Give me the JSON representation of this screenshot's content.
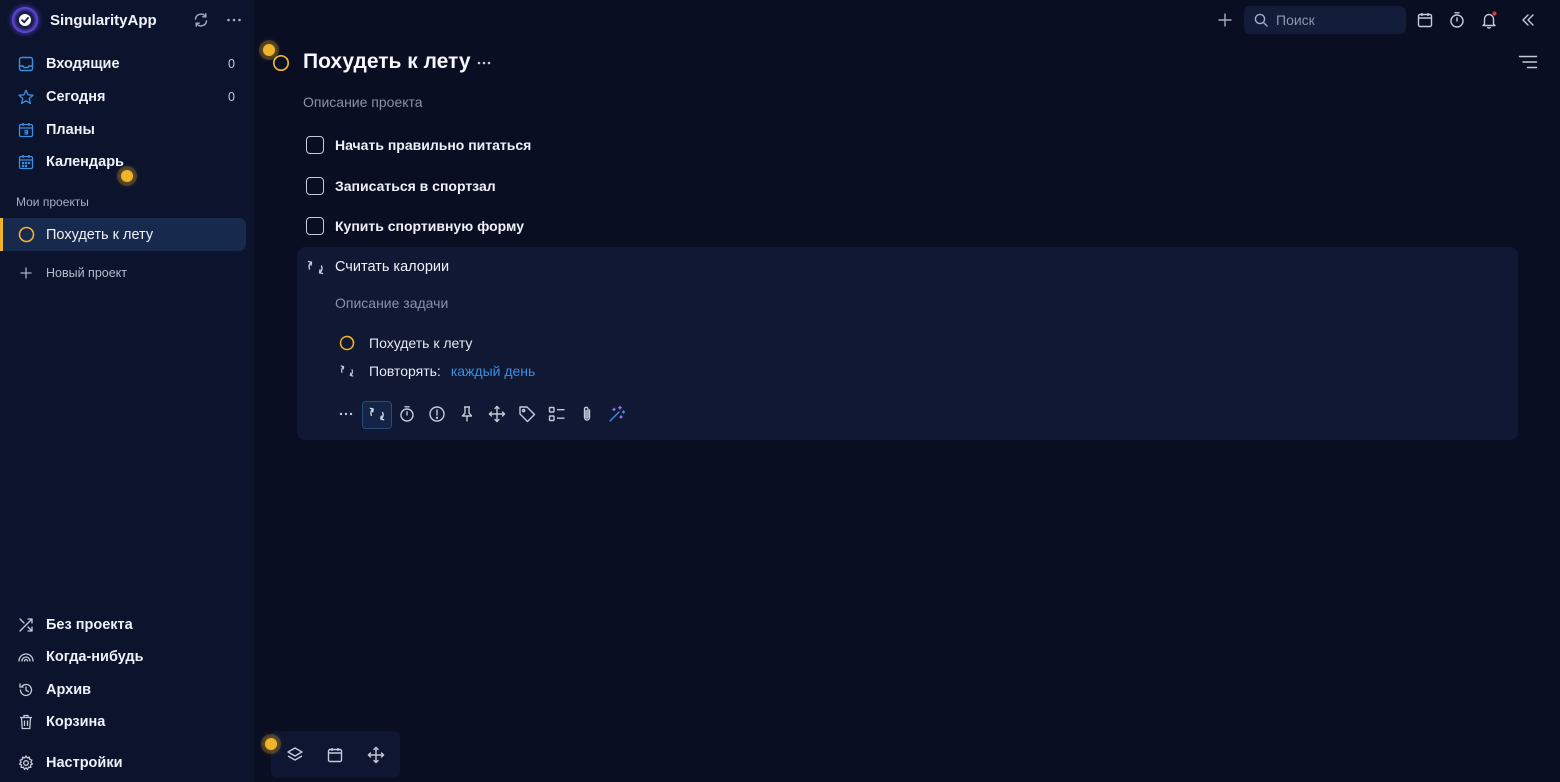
{
  "app": {
    "name": "SingularityApp"
  },
  "sidebar": {
    "nav": [
      {
        "label": "Входящие",
        "count": "0",
        "icon": "inbox-icon"
      },
      {
        "label": "Сегодня",
        "count": "0",
        "icon": "star-icon"
      },
      {
        "label": "Планы",
        "icon": "calendar-plans-icon"
      },
      {
        "label": "Календарь",
        "icon": "calendar-icon"
      }
    ],
    "projects_title": "Мои проекты",
    "active_project": "Похудеть к лету",
    "new_project": "Новый проект",
    "bottom": [
      {
        "label": "Без проекта",
        "icon": "shuffle-icon"
      },
      {
        "label": "Когда-нибудь",
        "icon": "rainbow-icon"
      },
      {
        "label": "Архив",
        "icon": "history-icon"
      },
      {
        "label": "Корзина",
        "icon": "trash-icon"
      },
      {
        "label": "Настройки",
        "icon": "gear-icon"
      }
    ]
  },
  "topbar": {
    "search_placeholder": "Поиск"
  },
  "project": {
    "title": "Похудеть к лету",
    "description": "Описание проекта",
    "tasks": [
      {
        "title": "Начать правильно питаться"
      },
      {
        "title": "Записаться в спортзал"
      },
      {
        "title": "Купить спортивную форму"
      }
    ]
  },
  "open_task": {
    "title": "Считать калории",
    "description": "Описание задачи",
    "project": "Похудеть к лету",
    "repeat_label": "Повторять:",
    "repeat_value": "каждый день"
  },
  "colors": {
    "accent": "#f0b429",
    "link": "#3b8fe0",
    "active_project_bg": "#17294d",
    "sidebar_bg": "#0c132d",
    "main_bg": "#0a0e22",
    "notification_dot": "#e53935"
  }
}
